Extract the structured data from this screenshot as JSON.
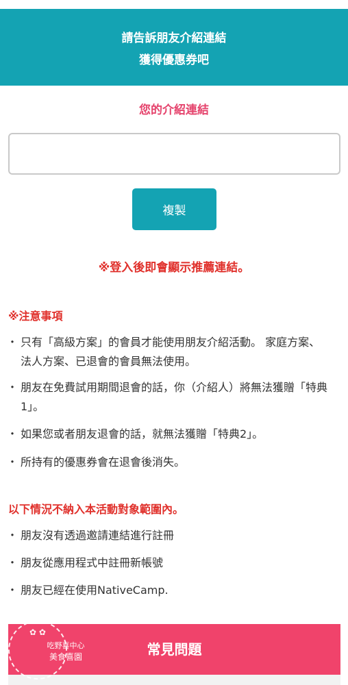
{
  "banner": {
    "line1": "請告訴朋友介紹連結",
    "line2": "獲得優惠券吧"
  },
  "referral": {
    "title": "您的介紹連結",
    "input_value": "",
    "copy_label": "複製",
    "login_notice": "※登入後即會顯示推薦連結。"
  },
  "notes": {
    "heading": "※注意事項",
    "items": [
      "只有「高級方案」的會員才能使用朋友介紹活動。 家庭方案、法人方案、已退會的會員無法使用。",
      "朋友在免費試用期間退會的話，你（介紹人）將無法獲贈「特典1」。",
      "如果您或者朋友退會的話，就無法獲贈「特典2」。",
      "所持有的優惠券會在退會後消失。"
    ]
  },
  "exclusions": {
    "heading": "以下情況不納入本活動對象範圍內。",
    "items": [
      "朋友沒有透過邀請連結進行註冊",
      "朋友從應用程式中註冊新帳號",
      "朋友已經在使用NativeCamp."
    ]
  },
  "faq": {
    "label": "常見問題"
  },
  "watermark": {
    "icon": "flower-icon",
    "line1": "吃野喜中心",
    "line2": "美食喜園"
  },
  "colors": {
    "primary": "#14a3b3",
    "pink": "#e5446d",
    "red": "#e0302b",
    "faq": "#f0436b"
  }
}
